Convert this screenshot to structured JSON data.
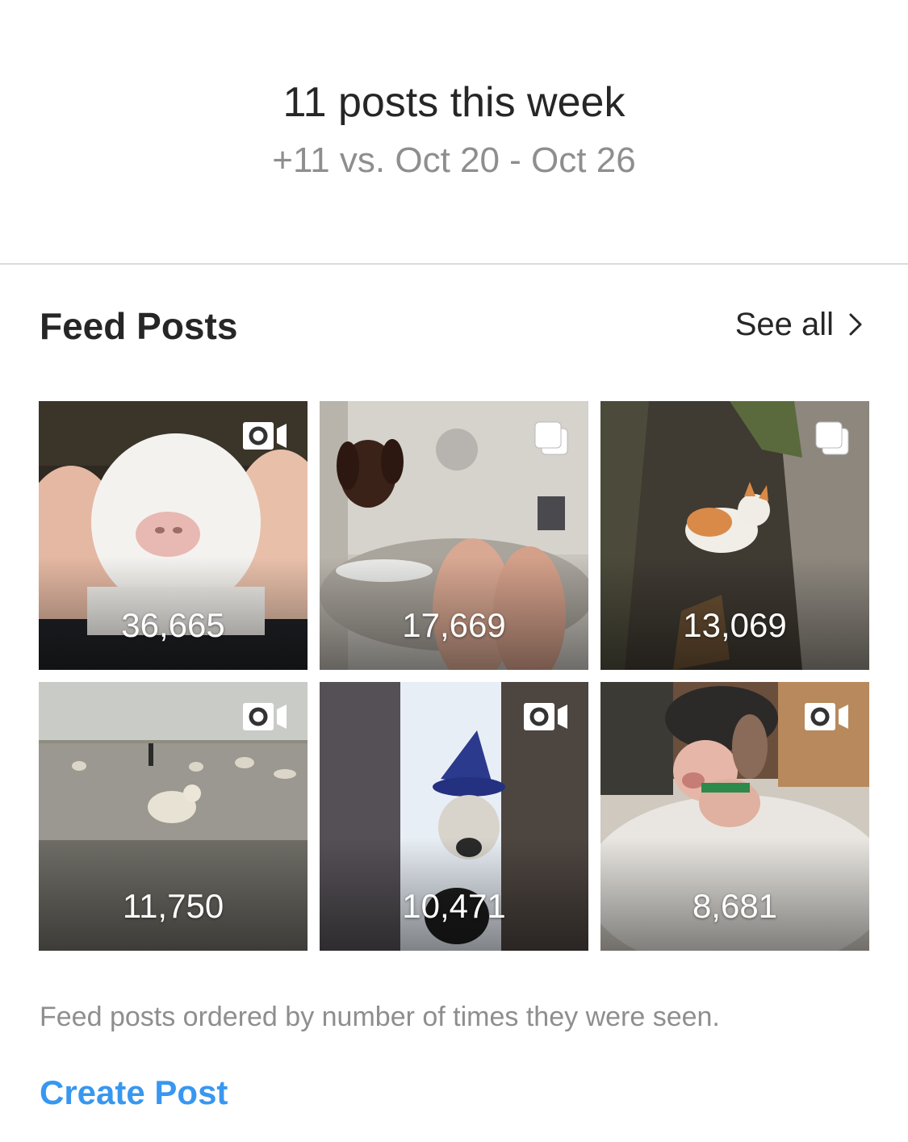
{
  "summary": {
    "title": "11 posts this week",
    "comparison": "+11 vs. Oct 20 - Oct 26"
  },
  "feed": {
    "section_title": "Feed Posts",
    "see_all_label": "See all",
    "posts": [
      {
        "count": "36,665",
        "type_icon": "video-icon",
        "subject": "goat"
      },
      {
        "count": "17,669",
        "type_icon": "carousel-icon",
        "subject": "dog-bathtub"
      },
      {
        "count": "13,069",
        "type_icon": "carousel-icon",
        "subject": "kitten"
      },
      {
        "count": "11,750",
        "type_icon": "video-icon",
        "subject": "dogs-beach"
      },
      {
        "count": "10,471",
        "type_icon": "video-icon",
        "subject": "dog-witch-hat"
      },
      {
        "count": "8,681",
        "type_icon": "video-icon",
        "subject": "piglet"
      }
    ],
    "footnote": "Feed posts ordered by number of times they were seen.",
    "create_label": "Create Post"
  },
  "colors": {
    "accent": "#3897f0",
    "text_primary": "#262626",
    "text_secondary": "#8e8e8e",
    "divider": "#dbdbdb"
  }
}
